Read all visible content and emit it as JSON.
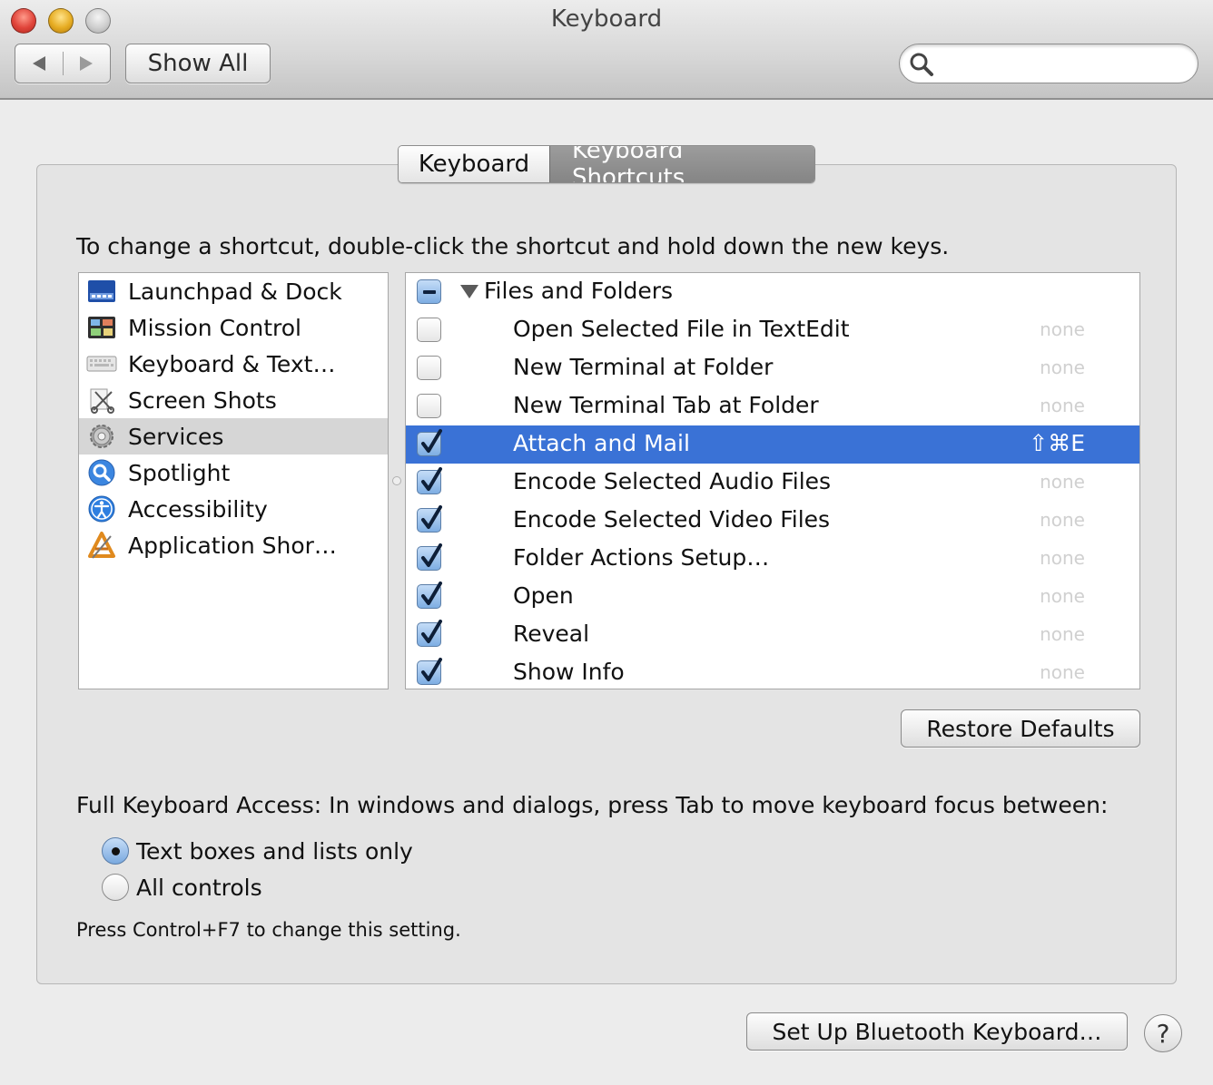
{
  "window": {
    "title": "Keyboard"
  },
  "toolbar": {
    "back_label": "◀",
    "forward_label": "▶",
    "show_all_label": "Show All",
    "search_placeholder": ""
  },
  "tabs": [
    {
      "label": "Keyboard",
      "selected": false
    },
    {
      "label": "Keyboard Shortcuts",
      "selected": true
    }
  ],
  "instruction": "To change a shortcut, double-click the shortcut and hold down the new keys.",
  "categories": [
    {
      "label": "Launchpad & Dock",
      "icon": "launchpad-dock-icon"
    },
    {
      "label": "Mission Control",
      "icon": "mission-control-icon"
    },
    {
      "label": "Keyboard & Text…",
      "icon": "keyboard-icon"
    },
    {
      "label": "Screen Shots",
      "icon": "screenshot-icon"
    },
    {
      "label": "Services",
      "icon": "gear-icon",
      "selected": true
    },
    {
      "label": "Spotlight",
      "icon": "spotlight-icon"
    },
    {
      "label": "Accessibility",
      "icon": "accessibility-icon"
    },
    {
      "label": "Application Shor…",
      "icon": "app-shortcuts-icon"
    }
  ],
  "services": {
    "group": {
      "label": "Files and Folders",
      "state": "mixed"
    },
    "items": [
      {
        "label": "Open Selected File in TextEdit",
        "checked": false,
        "shortcut": "none"
      },
      {
        "label": "New Terminal at Folder",
        "checked": false,
        "shortcut": "none"
      },
      {
        "label": "New Terminal Tab at Folder",
        "checked": false,
        "shortcut": "none"
      },
      {
        "label": "Attach and Mail",
        "checked": true,
        "shortcut": "⇧⌘E",
        "selected": true
      },
      {
        "label": "Encode Selected Audio Files",
        "checked": true,
        "shortcut": "none"
      },
      {
        "label": "Encode Selected Video Files",
        "checked": true,
        "shortcut": "none"
      },
      {
        "label": "Folder Actions Setup…",
        "checked": true,
        "shortcut": "none"
      },
      {
        "label": "Open",
        "checked": true,
        "shortcut": "none"
      },
      {
        "label": "Reveal",
        "checked": true,
        "shortcut": "none"
      },
      {
        "label": "Show Info",
        "checked": true,
        "shortcut": "none"
      }
    ]
  },
  "restore_defaults_label": "Restore Defaults",
  "full_keyboard_access": {
    "label": "Full Keyboard Access: In windows and dialogs, press Tab to move keyboard focus between:",
    "options": [
      {
        "label": "Text boxes and lists only",
        "selected": true
      },
      {
        "label": "All controls",
        "selected": false
      }
    ],
    "hint": "Press Control+F7 to change this setting."
  },
  "bluetooth_button_label": "Set Up Bluetooth Keyboard…",
  "help_label": "?",
  "colors": {
    "selection": "#3a72d6",
    "checkbox_checked": "#7eaee3",
    "segment_selected": "#8f8f8f"
  }
}
